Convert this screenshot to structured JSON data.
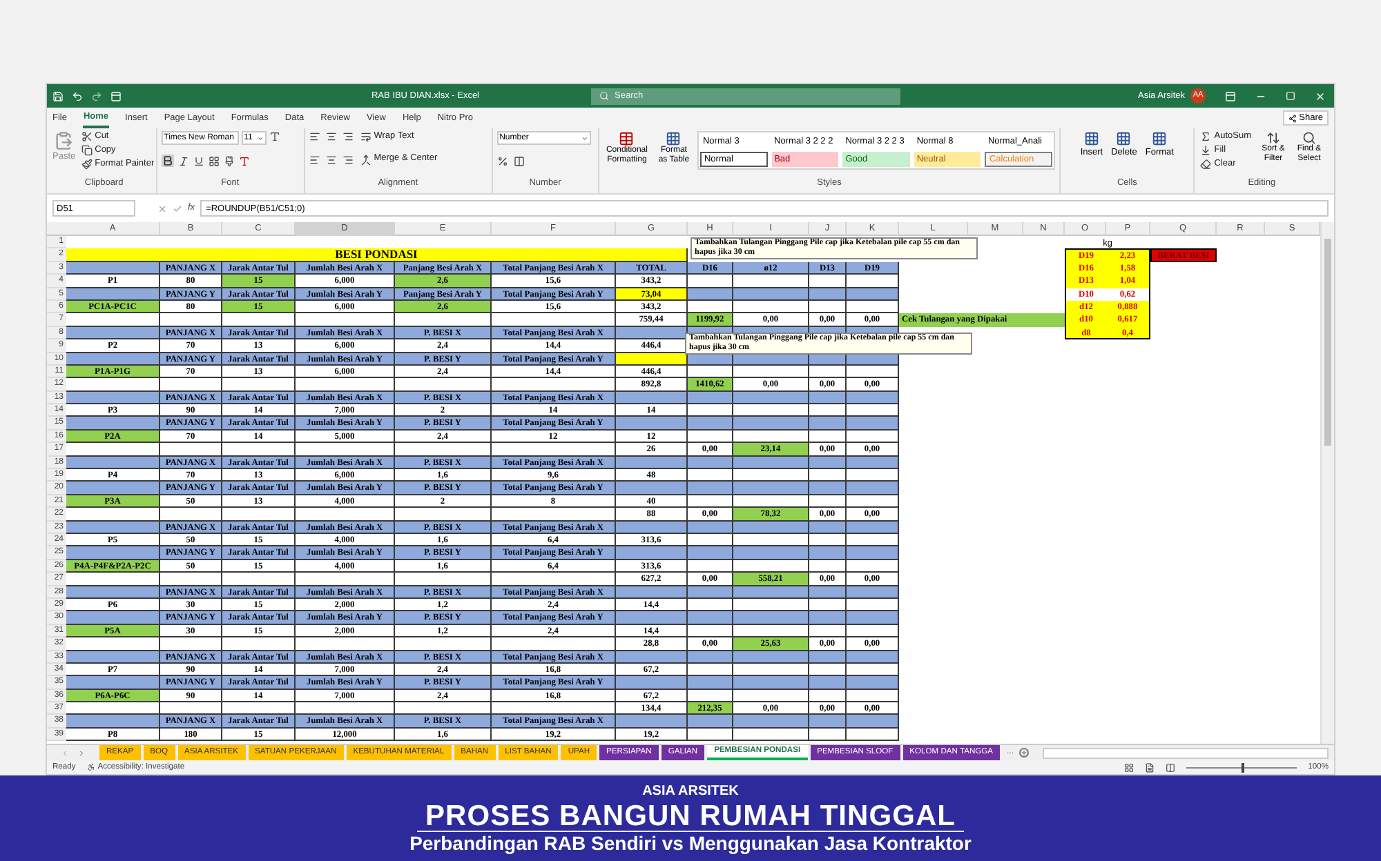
{
  "window": {
    "title": "RAB IBU DIAN.xlsx  -  Excel",
    "search_placeholder": "Search",
    "user": "Asia Arsitek",
    "avatar": "AA"
  },
  "menu": [
    {
      "label": "File",
      "selected": false
    },
    {
      "label": "Home",
      "selected": true
    },
    {
      "label": "Insert",
      "selected": false
    },
    {
      "label": "Page Layout",
      "selected": false
    },
    {
      "label": "Formulas",
      "selected": false
    },
    {
      "label": "Data",
      "selected": false
    },
    {
      "label": "Review",
      "selected": false
    },
    {
      "label": "View",
      "selected": false
    },
    {
      "label": "Help",
      "selected": false
    },
    {
      "label": "Nitro Pro",
      "selected": false
    }
  ],
  "share": "Share",
  "ribbon": {
    "clipboard": {
      "label": "Clipboard",
      "paste": "Paste",
      "cut": "Cut",
      "copy": "Copy",
      "format_painter": "Format Painter"
    },
    "font": {
      "label": "Font",
      "family": "Times New Roman",
      "size": "11"
    },
    "alignment": {
      "label": "Alignment",
      "wrap": "Wrap Text",
      "merge": "Merge & Center"
    },
    "number": {
      "label": "Number",
      "format": "Number"
    },
    "styles": {
      "label": "Styles",
      "conditional": "Conditional Formatting",
      "format_table": "Format as Table",
      "cells": [
        {
          "text": "Normal 3",
          "kind": "plain"
        },
        {
          "text": "Normal 3 2 2 2",
          "kind": "plain"
        },
        {
          "text": "Normal 3 2 2 3",
          "kind": "plain"
        },
        {
          "text": "Normal 8",
          "kind": "plain"
        },
        {
          "text": "Normal_Anali",
          "kind": "plain"
        },
        {
          "text": "Normal",
          "kind": "normal"
        },
        {
          "text": "Bad",
          "kind": "bad"
        },
        {
          "text": "Good",
          "kind": "good"
        },
        {
          "text": "Neutral",
          "kind": "neutral"
        },
        {
          "text": "Calculation",
          "kind": "calculation"
        }
      ]
    },
    "cells": {
      "label": "Cells",
      "items": [
        "Insert",
        "Delete",
        "Format"
      ]
    },
    "editing": {
      "label": "Editing",
      "autosum": "AutoSum",
      "fill": "Fill",
      "clear": "Clear",
      "sort": "Sort & Filter",
      "find": "Find & Select"
    }
  },
  "formula_bar": {
    "name_box": "D51",
    "function_label": "fx",
    "formula": "=ROUNDUP(B51/C51;0)"
  },
  "sheet": {
    "columns": [
      "A",
      "B",
      "C",
      "D",
      "E",
      "F",
      "G",
      "H",
      "I",
      "J",
      "K",
      "L",
      "M",
      "N",
      "O",
      "P",
      "Q",
      "R",
      "S"
    ],
    "rows": [
      {
        "n": "1",
        "kind": "blank"
      },
      {
        "n": "2",
        "kind": "title",
        "title": "BESI PONDASI"
      },
      {
        "n": "3",
        "kind": "band",
        "cells": [
          {},
          {
            "text": "PANJANG X"
          },
          {
            "text": "Jarak Antar Tul"
          },
          {
            "text": "Jumlah Besi Arah X"
          },
          {
            "text": "Panjang Besi Arah X"
          },
          {
            "text": "Total Panjang Besi Arah X"
          },
          {
            "text": "TOTAL"
          },
          {
            "text": "D16"
          },
          {
            "text": "ø12"
          },
          {
            "text": "D13"
          },
          {
            "text": "D19"
          }
        ]
      },
      {
        "n": "4",
        "kind": "data",
        "cells": [
          {
            "text": "P1"
          },
          {
            "text": "80"
          },
          {
            "text": "15",
            "color": "#92d050"
          },
          {
            "text": "6,000"
          },
          {
            "text": "2,6",
            "color": "#92d050"
          },
          {
            "text": "15,6"
          },
          {
            "text": "343,2"
          }
        ]
      },
      {
        "n": "5",
        "kind": "band",
        "cells": [
          {},
          {
            "text": "PANJANG Y"
          },
          {
            "text": "Jarak Antar Tul"
          },
          {
            "text": "Jumlah Besi Arah Y"
          },
          {
            "text": "Panjang Besi Arah Y"
          },
          {
            "text": "Total Panjang Besi Arah Y"
          },
          {
            "text": "73,04",
            "color": "#ffff00"
          }
        ]
      },
      {
        "n": "6",
        "kind": "data",
        "cells": [
          {
            "text": "PC1A-PC1C",
            "color": "#92d050"
          },
          {
            "text": "80"
          },
          {
            "text": "15",
            "color": "#92d050"
          },
          {
            "text": "6,000"
          },
          {
            "text": "2,6",
            "color": "#92d050"
          },
          {
            "text": "15,6"
          },
          {
            "text": "343,2"
          }
        ]
      },
      {
        "n": "7",
        "kind": "sum",
        "cells": [
          {},
          {},
          {},
          {},
          {},
          {},
          {
            "text": "759,44"
          },
          {
            "text": "1199,92",
            "color": "#92d050"
          },
          {
            "text": "0,00"
          },
          {
            "text": "0,00"
          },
          {
            "text": "0,00"
          }
        ]
      },
      {
        "n": "8",
        "kind": "band",
        "cells": [
          {},
          {
            "text": "PANJANG X"
          },
          {
            "text": "Jarak Antar Tul"
          },
          {
            "text": "Jumlah Besi Arah X"
          },
          {
            "text": "P. BESI X"
          },
          {
            "text": "Total Panjang Besi Arah X"
          }
        ]
      },
      {
        "n": "9",
        "kind": "data",
        "cells": [
          {
            "text": "P2"
          },
          {
            "text": "70"
          },
          {
            "text": "13"
          },
          {
            "text": "6,000"
          },
          {
            "text": "2,4"
          },
          {
            "text": "14,4"
          },
          {
            "text": "446,4"
          }
        ]
      },
      {
        "n": "10",
        "kind": "band",
        "cells": [
          {},
          {
            "text": "PANJANG Y"
          },
          {
            "text": "Jarak Antar Tul"
          },
          {
            "text": "Jumlah Besi Arah Y"
          },
          {
            "text": "P. BESI Y"
          },
          {
            "text": "Total Panjang Besi Arah Y"
          },
          {
            "color": "#ffff00"
          }
        ]
      },
      {
        "n": "11",
        "kind": "data",
        "cells": [
          {
            "text": "P1A-P1G",
            "color": "#92d050"
          },
          {
            "text": "70"
          },
          {
            "text": "13"
          },
          {
            "text": "6,000"
          },
          {
            "text": "2,4"
          },
          {
            "text": "14,4"
          },
          {
            "text": "446,4"
          }
        ]
      },
      {
        "n": "12",
        "kind": "sum",
        "cells": [
          {},
          {},
          {},
          {},
          {},
          {},
          {
            "text": "892,8"
          },
          {
            "text": "1410,62",
            "color": "#92d050"
          },
          {
            "text": "0,00"
          },
          {
            "text": "0,00"
          },
          {
            "text": "0,00"
          }
        ]
      },
      {
        "n": "13",
        "kind": "band",
        "cells": [
          {},
          {
            "text": "PANJANG X"
          },
          {
            "text": "Jarak Antar Tul"
          },
          {
            "text": "Jumlah Besi Arah X"
          },
          {
            "text": "P. BESI X"
          },
          {
            "text": "Total Panjang Besi Arah X"
          }
        ]
      },
      {
        "n": "14",
        "kind": "data",
        "cells": [
          {
            "text": "P3"
          },
          {
            "text": "90"
          },
          {
            "text": "14"
          },
          {
            "text": "7,000"
          },
          {
            "text": "2"
          },
          {
            "text": "14"
          },
          {
            "text": "14"
          }
        ]
      },
      {
        "n": "15",
        "kind": "band",
        "cells": [
          {},
          {
            "text": "PANJANG Y"
          },
          {
            "text": "Jarak Antar Tul"
          },
          {
            "text": "Jumlah Besi Arah Y"
          },
          {
            "text": "P. BESI Y"
          },
          {
            "text": "Total Panjang Besi Arah Y"
          }
        ]
      },
      {
        "n": "16",
        "kind": "data",
        "cells": [
          {
            "text": "P2A",
            "color": "#92d050"
          },
          {
            "text": "70"
          },
          {
            "text": "14"
          },
          {
            "text": "5,000"
          },
          {
            "text": "2,4"
          },
          {
            "text": "12"
          },
          {
            "text": "12"
          }
        ]
      },
      {
        "n": "17",
        "kind": "sum",
        "cells": [
          {},
          {},
          {},
          {},
          {},
          {},
          {
            "text": "26"
          },
          {
            "text": "0,00"
          },
          {
            "text": "23,14",
            "color": "#92d050"
          },
          {
            "text": "0,00"
          },
          {
            "text": "0,00"
          }
        ]
      },
      {
        "n": "18",
        "kind": "band",
        "cells": [
          {},
          {
            "text": "PANJANG X"
          },
          {
            "text": "Jarak Antar Tul"
          },
          {
            "text": "Jumlah Besi Arah X"
          },
          {
            "text": "P. BESI X"
          },
          {
            "text": "Total Panjang Besi Arah X"
          }
        ]
      },
      {
        "n": "19",
        "kind": "data",
        "cells": [
          {
            "text": "P4"
          },
          {
            "text": "70"
          },
          {
            "text": "13"
          },
          {
            "text": "6,000"
          },
          {
            "text": "1,6"
          },
          {
            "text": "9,6"
          },
          {
            "text": "48"
          }
        ]
      },
      {
        "n": "20",
        "kind": "band",
        "cells": [
          {},
          {
            "text": "PANJANG Y"
          },
          {
            "text": "Jarak Antar Tul"
          },
          {
            "text": "Jumlah Besi Arah Y"
          },
          {
            "text": "P. BESI Y"
          },
          {
            "text": "Total Panjang Besi Arah Y"
          }
        ]
      },
      {
        "n": "21",
        "kind": "data",
        "cells": [
          {
            "text": "P3A",
            "color": "#92d050"
          },
          {
            "text": "50"
          },
          {
            "text": "13"
          },
          {
            "text": "4,000"
          },
          {
            "text": "2"
          },
          {
            "text": "8"
          },
          {
            "text": "40"
          }
        ]
      },
      {
        "n": "22",
        "kind": "sum",
        "cells": [
          {},
          {},
          {},
          {},
          {},
          {},
          {
            "text": "88"
          },
          {
            "text": "0,00"
          },
          {
            "text": "78,32",
            "color": "#92d050"
          },
          {
            "text": "0,00"
          },
          {
            "text": "0,00"
          }
        ]
      },
      {
        "n": "23",
        "kind": "band",
        "cells": [
          {},
          {
            "text": "PANJANG X"
          },
          {
            "text": "Jarak Antar Tul"
          },
          {
            "text": "Jumlah Besi Arah X"
          },
          {
            "text": "P. BESI X"
          },
          {
            "text": "Total Panjang Besi Arah X"
          }
        ]
      },
      {
        "n": "24",
        "kind": "data",
        "cells": [
          {
            "text": "P5"
          },
          {
            "text": "50"
          },
          {
            "text": "15"
          },
          {
            "text": "4,000"
          },
          {
            "text": "1,6"
          },
          {
            "text": "6,4"
          },
          {
            "text": "313,6"
          }
        ]
      },
      {
        "n": "25",
        "kind": "band",
        "cells": [
          {},
          {
            "text": "PANJANG Y"
          },
          {
            "text": "Jarak Antar Tul"
          },
          {
            "text": "Jumlah Besi Arah Y"
          },
          {
            "text": "P. BESI Y"
          },
          {
            "text": "Total Panjang Besi Arah Y"
          }
        ]
      },
      {
        "n": "26",
        "kind": "data",
        "cells": [
          {
            "text": "P4A-P4F&P2A-P2C",
            "color": "#92d050"
          },
          {
            "text": "50"
          },
          {
            "text": "15"
          },
          {
            "text": "4,000"
          },
          {
            "text": "1,6"
          },
          {
            "text": "6,4"
          },
          {
            "text": "313,6"
          }
        ]
      },
      {
        "n": "27",
        "kind": "sum",
        "cells": [
          {},
          {},
          {},
          {},
          {},
          {},
          {
            "text": "627,2"
          },
          {
            "text": "0,00"
          },
          {
            "text": "558,21",
            "color": "#92d050"
          },
          {
            "text": "0,00"
          },
          {
            "text": "0,00"
          }
        ]
      },
      {
        "n": "28",
        "kind": "band",
        "cells": [
          {},
          {
            "text": "PANJANG X"
          },
          {
            "text": "Jarak Antar Tul"
          },
          {
            "text": "Jumlah Besi Arah X"
          },
          {
            "text": "P. BESI X"
          },
          {
            "text": "Total Panjang Besi Arah X"
          }
        ]
      },
      {
        "n": "29",
        "kind": "data",
        "cells": [
          {
            "text": "P6"
          },
          {
            "text": "30"
          },
          {
            "text": "15"
          },
          {
            "text": "2,000"
          },
          {
            "text": "1,2"
          },
          {
            "text": "2,4"
          },
          {
            "text": "14,4"
          }
        ]
      },
      {
        "n": "30",
        "kind": "band",
        "cells": [
          {},
          {
            "text": "PANJANG Y"
          },
          {
            "text": "Jarak Antar Tul"
          },
          {
            "text": "Jumlah Besi Arah Y"
          },
          {
            "text": "P. BESI Y"
          },
          {
            "text": "Total Panjang Besi Arah Y"
          }
        ]
      },
      {
        "n": "31",
        "kind": "data",
        "cells": [
          {
            "text": "P5A",
            "color": "#92d050"
          },
          {
            "text": "30"
          },
          {
            "text": "15"
          },
          {
            "text": "2,000"
          },
          {
            "text": "1,2"
          },
          {
            "text": "2,4"
          },
          {
            "text": "14,4"
          }
        ]
      },
      {
        "n": "32",
        "kind": "sum",
        "cells": [
          {},
          {},
          {},
          {},
          {},
          {},
          {
            "text": "28,8"
          },
          {
            "text": "0,00"
          },
          {
            "text": "25,63",
            "color": "#92d050"
          },
          {
            "text": "0,00"
          },
          {
            "text": "0,00"
          }
        ]
      },
      {
        "n": "33",
        "kind": "band",
        "cells": [
          {},
          {
            "text": "PANJANG X"
          },
          {
            "text": "Jarak Antar Tul"
          },
          {
            "text": "Jumlah Besi Arah X"
          },
          {
            "text": "P. BESI X"
          },
          {
            "text": "Total Panjang Besi Arah X"
          }
        ]
      },
      {
        "n": "34",
        "kind": "data",
        "cells": [
          {
            "text": "P7"
          },
          {
            "text": "90"
          },
          {
            "text": "14"
          },
          {
            "text": "7,000"
          },
          {
            "text": "2,4"
          },
          {
            "text": "16,8"
          },
          {
            "text": "67,2"
          }
        ]
      },
      {
        "n": "35",
        "kind": "band",
        "cells": [
          {},
          {
            "text": "PANJANG Y"
          },
          {
            "text": "Jarak Antar Tul"
          },
          {
            "text": "Jumlah Besi Arah Y"
          },
          {
            "text": "P. BESI Y"
          },
          {
            "text": "Total Panjang Besi Arah Y"
          }
        ]
      },
      {
        "n": "36",
        "kind": "data",
        "cells": [
          {
            "text": "P6A-P6C",
            "color": "#92d050"
          },
          {
            "text": "90"
          },
          {
            "text": "14"
          },
          {
            "text": "7,000"
          },
          {
            "text": "2,4"
          },
          {
            "text": "16,8"
          },
          {
            "text": "67,2"
          }
        ]
      },
      {
        "n": "37",
        "kind": "sum",
        "cells": [
          {},
          {},
          {},
          {},
          {},
          {},
          {
            "text": "134,4"
          },
          {
            "text": "212,35",
            "color": "#92d050"
          },
          {
            "text": "0,00"
          },
          {
            "text": "0,00"
          },
          {
            "text": "0,00"
          }
        ]
      },
      {
        "n": "38",
        "kind": "band",
        "cells": [
          {},
          {
            "text": "PANJANG X"
          },
          {
            "text": "Jarak Antar Tul"
          },
          {
            "text": "Jumlah Besi Arah X"
          },
          {
            "text": "P. BESI X"
          },
          {
            "text": "Total Panjang Besi Arah X"
          }
        ]
      },
      {
        "n": "39",
        "kind": "data",
        "cells": [
          {
            "text": "P8"
          },
          {
            "text": "180"
          },
          {
            "text": "15"
          },
          {
            "text": "12,000"
          },
          {
            "text": "1,6"
          },
          {
            "text": "19,2"
          },
          {
            "text": "19,2"
          }
        ]
      }
    ],
    "check_label": "Cek Tulangan yang Dipakai",
    "weight_table": {
      "unit": "kg",
      "label": "BERAT BESI",
      "rows": [
        {
          "name": "D19",
          "value": "2,23",
          "color": "#ffff00"
        },
        {
          "name": "D16",
          "value": "1,58",
          "color": "#ffff00"
        },
        {
          "name": "D13",
          "value": "1,04",
          "color": "#ffff00"
        },
        {
          "name": "D10",
          "value": "0,62"
        },
        {
          "name": "d12",
          "value": "0,888",
          "color": "#ffff00"
        },
        {
          "name": "d10",
          "value": "0,617",
          "color": "#ffff00"
        },
        {
          "name": "d8",
          "value": "0,4",
          "color": "#ffff00"
        }
      ]
    },
    "notes": [
      {
        "text": "Tambahkan Tulangan Pinggang Pile cap jika Ketebalan pile cap 55 cm dan hapus jika 30 cm"
      },
      {
        "text": "Tambahkan Tulangan Pinggang Pile cap jika Ketebalan pile cap 55 cm dan hapus jika 30 cm"
      }
    ]
  },
  "sheet_tabs": [
    {
      "label": "REKAP",
      "color": "#ffc000",
      "selected": false
    },
    {
      "label": "BOQ",
      "color": "#ffc000",
      "selected": false
    },
    {
      "label": "ASIA ARSITEK",
      "color": "#ffc000",
      "selected": false
    },
    {
      "label": "SATUAN PEKERJAAN",
      "color": "#ffc000",
      "selected": false
    },
    {
      "label": "KEBUTUHAN MATERIAL",
      "color": "#ffc000",
      "selected": false
    },
    {
      "label": "BAHAN",
      "color": "#ffc000",
      "selected": false
    },
    {
      "label": "LIST BAHAN",
      "color": "#ffc000",
      "selected": false
    },
    {
      "label": "UPAH",
      "color": "#ffc000",
      "selected": false
    },
    {
      "label": "PERSIAPAN",
      "color": "#7030a0",
      "selected": false
    },
    {
      "label": "GALIAN",
      "color": "#7030a0",
      "selected": false
    },
    {
      "label": "PEMBESIAN PONDASI",
      "color": "#00b050",
      "selected": true
    },
    {
      "label": "PEMBESIAN SLOOF",
      "color": "#7030a0",
      "selected": false
    },
    {
      "label": "KOLOM DAN TANGGA",
      "color": "#7030a0",
      "selected": false
    }
  ],
  "tabs_more": "...",
  "status_bar": {
    "ready": "Ready",
    "accessibility": "Accessibility: Investigate",
    "zoom": "100%",
    "zoom_level": {
      "level": 0.5
    }
  },
  "banner": {
    "brand": "ASIA ARSITEK",
    "title": "PROSES BANGUN RUMAH TINGGAL",
    "subtitle": "Perbandingan RAB Sendiri vs Menggunakan Jasa Kontraktor"
  }
}
